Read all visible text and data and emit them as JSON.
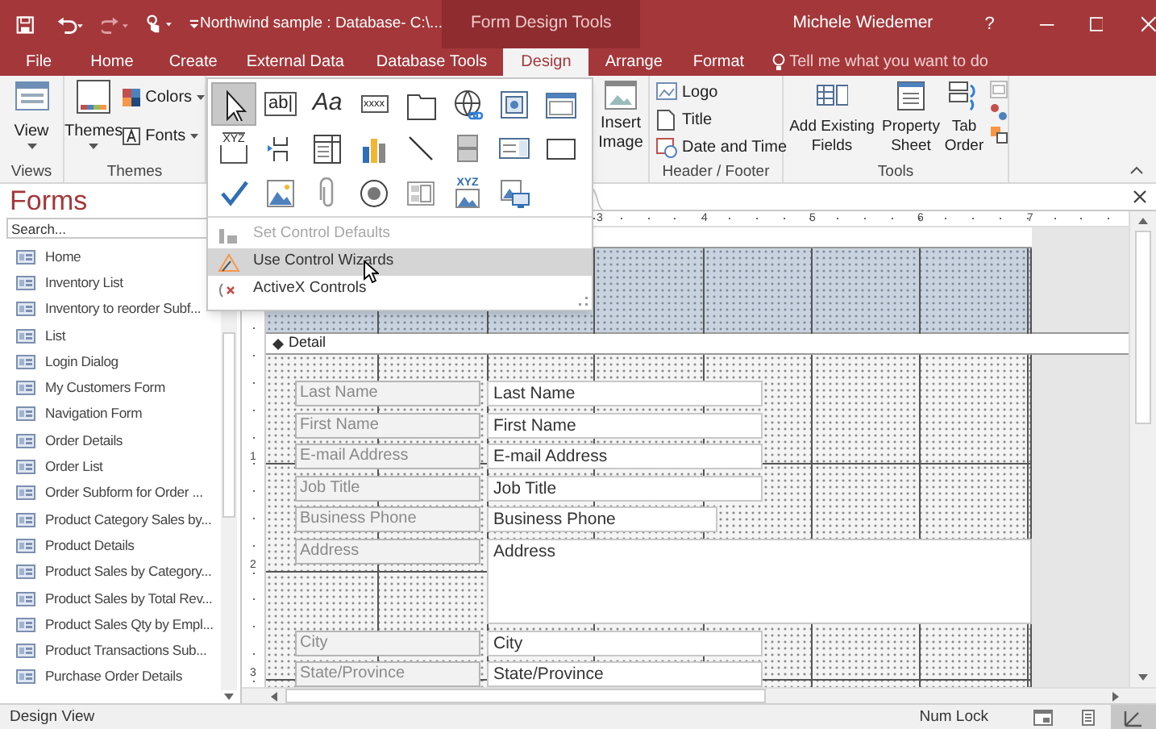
{
  "title_bar": {
    "title": "Northwind sample : Database- C:\\...",
    "context_tab": "Form Design Tools",
    "user": "Michele Wiedemer",
    "help": "?"
  },
  "ribbon_tabs": [
    {
      "label": "File",
      "selected": false
    },
    {
      "label": "Home",
      "selected": false
    },
    {
      "label": "Create",
      "selected": false
    },
    {
      "label": "External Data",
      "selected": false
    },
    {
      "label": "Database Tools",
      "selected": false
    },
    {
      "label": "Design",
      "selected": true
    },
    {
      "label": "Arrange",
      "selected": false
    },
    {
      "label": "Format",
      "selected": false
    }
  ],
  "tell_me": {
    "placeholder": "Tell me what you want to do"
  },
  "ribbon": {
    "views": {
      "label": "Views",
      "button": "View"
    },
    "themes": {
      "label": "Themes",
      "button": "Themes",
      "colors": "Colors",
      "fonts": "Fonts"
    },
    "insert_image": "Insert Image",
    "header_footer": {
      "label": "Header / Footer",
      "buttons": [
        "Logo",
        "Title",
        "Date and Time"
      ]
    },
    "tools": {
      "label": "Tools",
      "buttons": [
        "Add Existing Fields",
        "Property Sheet",
        "Tab Order"
      ]
    }
  },
  "controls_menu": {
    "gallery": [
      {
        "kind": "pointer",
        "selected": true
      },
      {
        "kind": "textbox",
        "glyph": "ab|",
        "selected": false
      },
      {
        "kind": "label",
        "glyph": "Aa",
        "selected": false
      },
      {
        "kind": "button",
        "glyph": "xxxx",
        "selected": false
      },
      {
        "kind": "tab",
        "selected": false
      },
      {
        "kind": "hyperlink",
        "selected": false
      },
      {
        "kind": "webbrowser",
        "selected": false
      },
      {
        "kind": "navigation",
        "selected": false
      },
      {
        "kind": "group",
        "glyph": "XYZ",
        "selected": false
      },
      {
        "kind": "pagebreak",
        "selected": false
      },
      {
        "kind": "combo",
        "selected": false
      },
      {
        "kind": "chart",
        "selected": false
      },
      {
        "kind": "line",
        "selected": false
      },
      {
        "kind": "toggle",
        "selected": false
      },
      {
        "kind": "listbox",
        "selected": false
      },
      {
        "kind": "rect",
        "selected": false
      },
      {
        "kind": "checkbox",
        "selected": false
      },
      {
        "kind": "image",
        "selected": false
      },
      {
        "kind": "attachment",
        "selected": false
      },
      {
        "kind": "option",
        "selected": false
      },
      {
        "kind": "subform",
        "selected": false
      },
      {
        "kind": "boundframe",
        "glyph": "XYZ",
        "selected": false
      },
      {
        "kind": "unboundframe",
        "selected": false
      }
    ],
    "items": [
      {
        "label": "Set Control Defaults",
        "disabled": true,
        "selected": false
      },
      {
        "label": "Use Control Wizards",
        "disabled": false,
        "selected": true
      },
      {
        "label": "ActiveX Controls",
        "disabled": false,
        "selected": false
      }
    ]
  },
  "nav_pane": {
    "title": "Forms",
    "search": {
      "placeholder": "Search..."
    },
    "items": [
      "Home",
      "Inventory List",
      "Inventory to reorder Subf...",
      "List",
      "Login Dialog",
      "My Customers Form",
      "Navigation Form",
      "Order Details",
      "Order List",
      "Order Subform for Order ...",
      "Product Category Sales by...",
      "Product Details",
      "Product Sales by Category...",
      "Product Sales by Total Rev...",
      "Product Sales Qty by Empl...",
      "Product Transactions Sub...",
      "Purchase Order Details"
    ]
  },
  "form_design": {
    "ruler_marks": [
      "3",
      "4",
      "5",
      "6",
      "7"
    ],
    "vertical_ruler_marks": [
      "1",
      "2",
      "3"
    ],
    "section": "Detail",
    "rows": [
      {
        "label": "Last Name",
        "field": "Last Name",
        "kind": "single"
      },
      {
        "label": "First Name",
        "field": "First Name",
        "kind": "single"
      },
      {
        "label": "E-mail Address",
        "field": "E-mail Address",
        "kind": "single"
      },
      {
        "label": "Job Title",
        "field": "Job Title",
        "kind": "single"
      },
      {
        "label": "Business Phone",
        "field": "Business Phone",
        "kind": "short"
      },
      {
        "label": "Address",
        "field": "Address",
        "kind": "multiline"
      },
      {
        "label": "City",
        "field": "City",
        "kind": "single"
      },
      {
        "label": "State/Province",
        "field": "State/Province",
        "kind": "single"
      }
    ]
  },
  "status_bar": {
    "mode": "Design View",
    "indicator": "Num Lock",
    "views": [
      {
        "kind": "form",
        "selected": false
      },
      {
        "kind": "layout",
        "selected": false
      },
      {
        "kind": "design",
        "selected": true
      }
    ]
  }
}
